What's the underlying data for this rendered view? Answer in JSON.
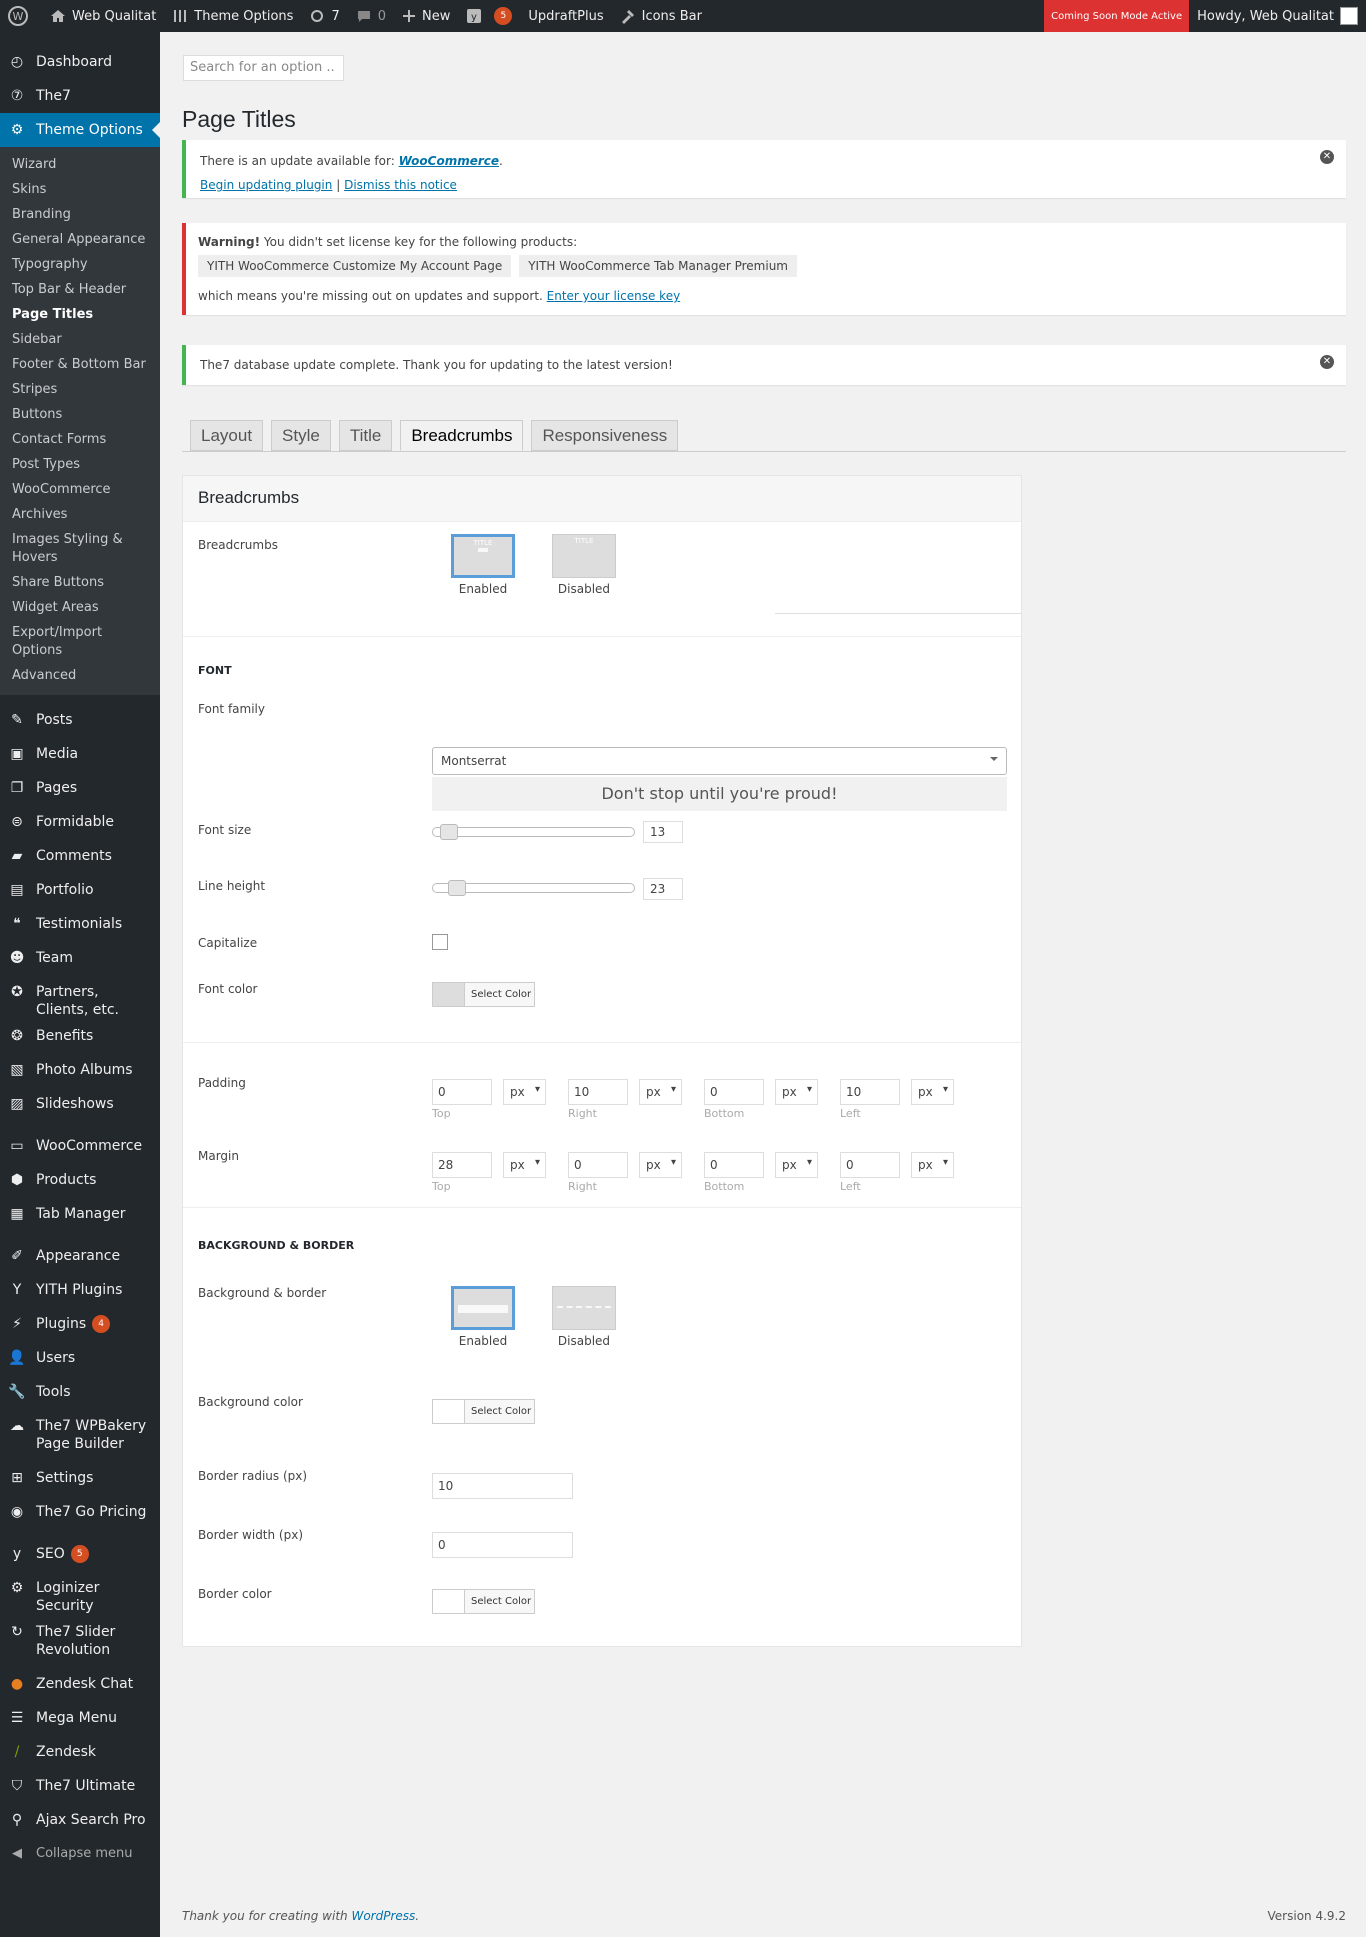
{
  "adminbar": {
    "site": "Web Qualitat",
    "theme_options": "Theme Options",
    "updates": "7",
    "comments": "0",
    "new": "New",
    "seo_badge": "5",
    "updraft": "UpdraftPlus",
    "icons_bar": "Icons Bar",
    "coming_soon": "Coming Soon Mode Active",
    "howdy": "Howdy, Web Qualitat"
  },
  "sidebar": {
    "top": [
      "Dashboard",
      "The7",
      "Theme Options"
    ],
    "submenu": [
      "Wizard",
      "Skins",
      "Branding",
      "General Appearance",
      "Typography",
      "Top Bar & Header",
      "Page Titles",
      "Sidebar",
      "Footer & Bottom Bar",
      "Stripes",
      "Buttons",
      "Contact Forms",
      "Post Types",
      "WooCommerce",
      "Archives",
      "Images Styling & Hovers",
      "Share Buttons",
      "Widget Areas",
      "Export/Import Options",
      "Advanced"
    ],
    "group1": [
      "Posts",
      "Media",
      "Pages",
      "Formidable",
      "Comments",
      "Portfolio",
      "Testimonials",
      "Team",
      "Partners, Clients, etc.",
      "Benefits",
      "Photo Albums",
      "Slideshows"
    ],
    "group2": [
      "WooCommerce",
      "Products",
      "Tab Manager"
    ],
    "group3": [
      "Appearance",
      "YITH Plugins",
      "Plugins",
      "Users",
      "Tools",
      "The7 WPBakery Page Builder",
      "Settings",
      "The7 Go Pricing"
    ],
    "plugins_badge": "4",
    "group4": [
      "SEO",
      "Loginizer Security",
      "The7 Slider Revolution",
      "Zendesk Chat",
      "Mega Menu",
      "Zendesk",
      "The7 Ultimate",
      "Ajax Search Pro",
      "Collapse menu"
    ],
    "seo_badge": "5"
  },
  "search_placeholder": "Search for an option ..",
  "page_title": "Page Titles",
  "notices": {
    "update_text": "There is an update available for: ",
    "update_link": "WooCommerce",
    "begin_link": "Begin updating plugin",
    "sep": "|",
    "dismiss_link": "Dismiss this notice",
    "warning_bold": "Warning!",
    "warning_text": " You didn't set license key for the following products:",
    "product1": "YITH WooCommerce Customize My Account Page",
    "product2": "YITH WooCommerce Tab Manager Premium",
    "missing_text": "which means you're missing out on updates and support. ",
    "license_link": "Enter your license key",
    "db_text": "The7 database update complete. Thank you for updating to the latest version!"
  },
  "tabs": [
    "Layout",
    "Style",
    "Title",
    "Breadcrumbs",
    "Responsiveness"
  ],
  "panel": {
    "heading": "Breadcrumbs",
    "breadcrumbs_label": "Breadcrumbs",
    "img_title": "TITLE",
    "enabled": "Enabled",
    "disabled": "Disabled",
    "font_heading": "FONT",
    "font_family_label": "Font family",
    "font_family_value": "Montserrat",
    "preview": "Don't stop until you're proud!",
    "font_size_label": "Font size",
    "font_size": "13",
    "font_size_fraction": 0.04,
    "line_height_label": "Line height",
    "line_height": "23",
    "line_height_fraction": 0.08,
    "capitalize_label": "Capitalize",
    "font_color_label": "Font color",
    "select_color": "Select Color",
    "padding_label": "Padding",
    "padding": [
      "0",
      "10",
      "0",
      "10"
    ],
    "margin_label": "Margin",
    "margin": [
      "28",
      "0",
      "0",
      "0"
    ],
    "unit": "px",
    "sides": [
      "Top",
      "Right",
      "Bottom",
      "Left"
    ],
    "bg_heading": "BACKGROUND & BORDER",
    "bg_border_label": "Background & border",
    "bg_color_label": "Background color",
    "border_radius_label": "Border radius (px)",
    "border_radius": "10",
    "border_width_label": "Border width (px)",
    "border_width": "0",
    "border_color_label": "Border color"
  },
  "footer": {
    "thanks": "Thank you for creating with ",
    "wp": "WordPress",
    "dot": ".",
    "version": "Version 4.9.2"
  },
  "colors": {
    "accent": "#0073aa",
    "adminbar": "#23282d",
    "danger": "#dc3232",
    "success": "#46b450"
  }
}
